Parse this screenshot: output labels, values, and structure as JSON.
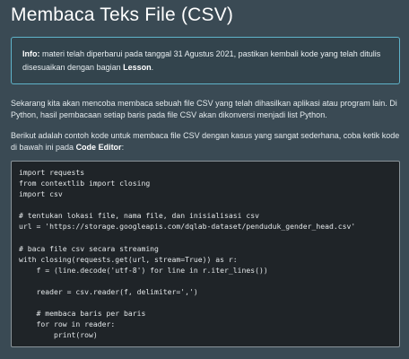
{
  "page": {
    "title": "Membaca Teks File (CSV)"
  },
  "info": {
    "label": "Info:",
    "text_before": " materi telah diperbarui pada tanggal 31 Agustus 2021, pastikan kembali kode yang telah ditulis disesuaikan dengan bagian ",
    "lesson": "Lesson",
    "text_after": "."
  },
  "paragraphs": {
    "p1": "Sekarang kita akan mencoba membaca sebuah file CSV yang telah dihasilkan aplikasi atau program lain. Di Python, hasil pembacaan setiap baris pada file CSV akan dikonversi menjadi list Python.",
    "p2_before": "Berikut adalah contoh kode untuk membaca file CSV dengan kasus yang sangat sederhana, coba ketik kode di bawah ini pada ",
    "p2_bold": "Code Editor",
    "p2_after": ":"
  },
  "code": {
    "lines": [
      "import requests",
      "from contextlib import closing",
      "import csv",
      "",
      "# tentukan lokasi file, nama file, dan inisialisasi csv",
      "url = 'https://storage.googleapis.com/dqlab-dataset/penduduk_gender_head.csv'",
      "",
      "# baca file csv secara streaming",
      "with closing(requests.get(url, stream=True)) as r:",
      "    f = (line.decode('utf-8') for line in r.iter_lines())",
      "",
      "    reader = csv.reader(f, delimiter=',')",
      "",
      "    # membaca baris per baris",
      "    for row in reader:",
      "        print(row)"
    ]
  }
}
